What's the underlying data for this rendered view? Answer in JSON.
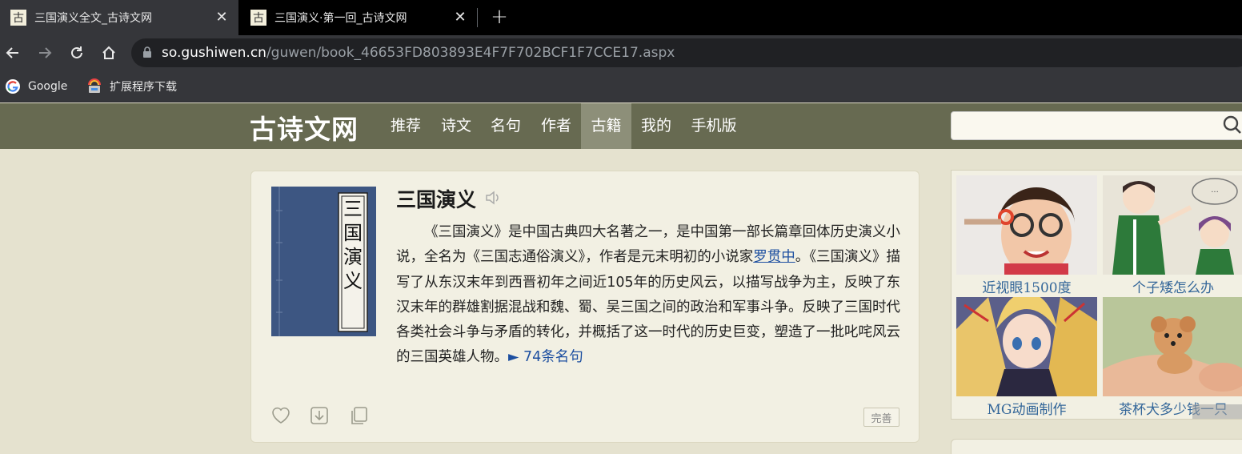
{
  "browser": {
    "tabs": [
      {
        "favicon": "古",
        "title": "三国演义全文_古诗文网",
        "close": "✕"
      },
      {
        "favicon": "古",
        "title": "三国演义·第一回_古诗文网",
        "close": "✕"
      }
    ],
    "new_tab": "+",
    "url": {
      "host": "so.gushiwen.cn",
      "path": "/guwen/book_46653FD803893E4F7F702BCF1F7CCE17.aspx"
    },
    "bookmarks": [
      {
        "label": "Google",
        "icon": "google-icon"
      },
      {
        "label": "扩展程序下载",
        "icon": "extension-folder-icon"
      }
    ]
  },
  "site": {
    "logo": "古诗文网",
    "nav": [
      {
        "label": "推荐",
        "active": false
      },
      {
        "label": "诗文",
        "active": false
      },
      {
        "label": "名句",
        "active": false
      },
      {
        "label": "作者",
        "active": false
      },
      {
        "label": "古籍",
        "active": true
      },
      {
        "label": "我的",
        "active": false
      },
      {
        "label": "手机版",
        "active": false
      }
    ],
    "search_placeholder": ""
  },
  "book": {
    "title": "三国演义",
    "cover_text": "三国演义",
    "desc_part1": "《三国演义》是中国古典四大名著之一，是中国第一部长篇章回体历史演义小说，全名为《三国志通俗演义》，作者是元末明初的小说家",
    "author_link": "罗贯中",
    "desc_part2": "。《三国演义》描写了从东汉末年到西晋初年之间近105年的历史风云，以描写战争为主，反映了东汉末年的群雄割据混战和魏、蜀、吴三国之间的政治和军事斗争。反映了三国时代各类社会斗争与矛盾的转化，并概括了这一时代的历史巨变，塑造了一批叱咤风云的三国英雄人物。",
    "more_link": "► 74条名句",
    "perfect_button": "完善"
  },
  "ads": [
    {
      "caption": "近视眼1500度",
      "image": "child-eye-test"
    },
    {
      "caption": "个子矮怎么办",
      "image": "cartoon-height"
    },
    {
      "caption": "MG动画制作",
      "image": "anime-girl"
    },
    {
      "caption": "茶杯犬多少钱一只",
      "image": "teacup-puppy"
    }
  ],
  "colors": {
    "nav_bg": "#676a51",
    "nav_active": "#8d8f79",
    "page_bg": "#e5e2cf",
    "card_bg": "#f2f0e3",
    "link": "#1d4fa0",
    "ad_caption": "#336699"
  }
}
